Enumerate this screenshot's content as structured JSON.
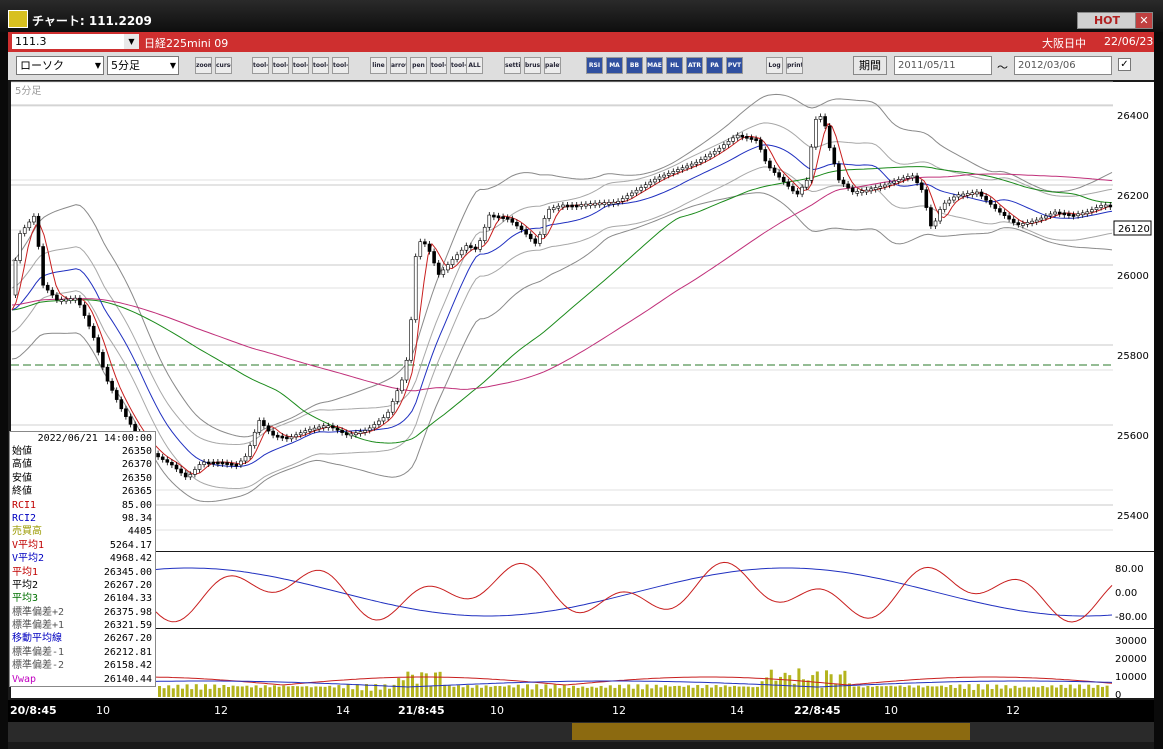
{
  "window": {
    "title": "チャート: 111.2209",
    "hot_label": "HOT",
    "close_label": "✕"
  },
  "symbolbar": {
    "code": "111.3",
    "name": "日経225mini 09",
    "session": "大阪日中",
    "date": "22/06/23"
  },
  "toolbar": {
    "chart_type": "ローソク",
    "interval": "5分足",
    "buttons": [
      "zoom",
      "cursor",
      "tool-a",
      "tool-b",
      "tool-c",
      "tool-d",
      "tool-e",
      "line",
      "arrow",
      "pen",
      "tool-f",
      "tool-g",
      "ALL",
      "settings",
      "brush",
      "palette",
      "RSI",
      "MA",
      "BB",
      "MAE",
      "HL",
      "ATR",
      "PA",
      "PVT",
      "Log",
      "print"
    ],
    "period_label": "期間",
    "start_date": "2011/05/11",
    "end_date": "2012/03/06",
    "tilde": "～"
  },
  "chart": {
    "interval_label": "5分足",
    "price_ticks": [
      "26400",
      "26200",
      "26000",
      "25800",
      "25600",
      "25400"
    ],
    "current_price": "26120",
    "osc_ticks": [
      "80.00",
      "0.00",
      "-80.00"
    ],
    "vol_ticks": [
      "30000",
      "20000",
      "10000",
      "0"
    ],
    "time_labels": [
      "20/8:45",
      "10",
      "12",
      "14",
      "21/8:45",
      "10",
      "12",
      "14",
      "22/8:45",
      "10",
      "12"
    ]
  },
  "infobox": {
    "timestamp": "2022/06/21 14:00:00",
    "rows": [
      {
        "label": "始値",
        "value": "26350",
        "color": "#000000"
      },
      {
        "label": "高値",
        "value": "26370",
        "color": "#000000"
      },
      {
        "label": "安値",
        "value": "26350",
        "color": "#000000"
      },
      {
        "label": "終値",
        "value": "26365",
        "color": "#000000"
      },
      {
        "label": "RCI1",
        "value": "85.00",
        "color": "#c00000"
      },
      {
        "label": "RCI2",
        "value": "98.34",
        "color": "#0000c0"
      },
      {
        "label": "売買高",
        "value": "4405",
        "color": "#9a9a00"
      },
      {
        "label": "V平均1",
        "value": "5264.17",
        "color": "#c00000"
      },
      {
        "label": "V平均2",
        "value": "4968.42",
        "color": "#0000c0"
      },
      {
        "label": "平均1",
        "value": "26345.00",
        "color": "#c00000"
      },
      {
        "label": "平均2",
        "value": "26267.20",
        "color": "#000000"
      },
      {
        "label": "平均3",
        "value": "26104.33",
        "color": "#007000"
      },
      {
        "label": "標準偏差+2",
        "value": "26375.98",
        "color": "#555555"
      },
      {
        "label": "標準偏差+1",
        "value": "26321.59",
        "color": "#555555"
      },
      {
        "label": "移動平均線",
        "value": "26267.20",
        "color": "#0000c0"
      },
      {
        "label": "標準偏差-1",
        "value": "26212.81",
        "color": "#555555"
      },
      {
        "label": "標準偏差-2",
        "value": "26158.42",
        "color": "#555555"
      },
      {
        "label": "Vwap",
        "value": "26140.44",
        "color": "#c000c0"
      }
    ]
  },
  "colors": {
    "ma1": "#c81e1e",
    "ma2": "#2030c0",
    "ma3": "#1a8a1a",
    "vwap": "#c0307a",
    "band": "#8a8a8a",
    "volume": "#b4b41e",
    "red_bar": "#ce2f2f"
  }
}
